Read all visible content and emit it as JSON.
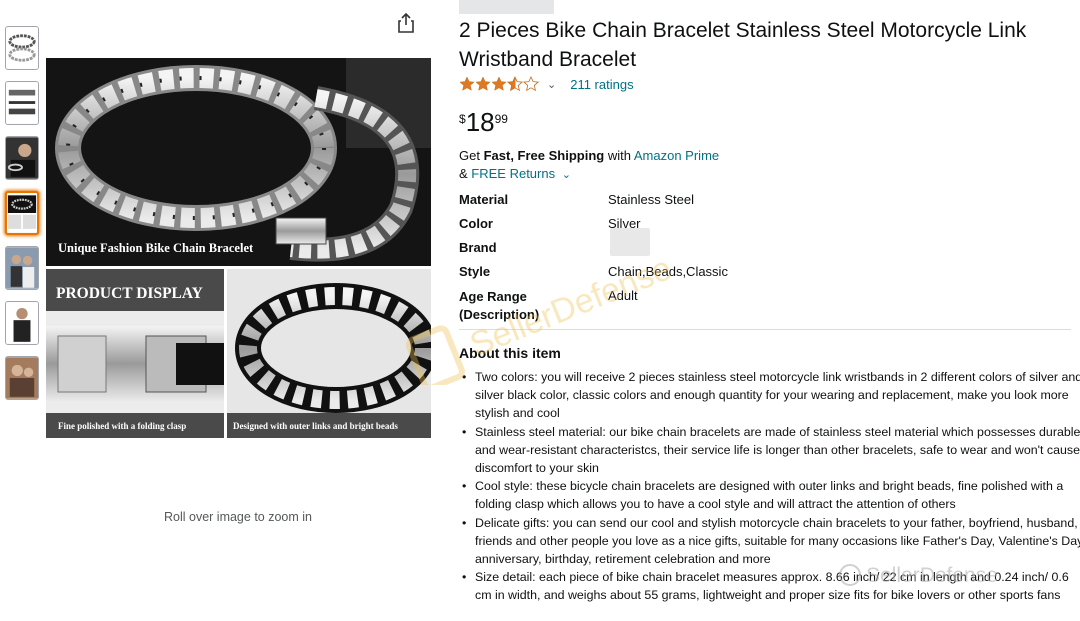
{
  "gallery": {
    "thumbnails": [
      {
        "name": "bracelet-pair"
      },
      {
        "name": "size-chart"
      },
      {
        "name": "model-wearing"
      },
      {
        "name": "product-display",
        "selected": true
      },
      {
        "name": "couple-photo"
      },
      {
        "name": "man-portrait"
      },
      {
        "name": "gift-photo"
      }
    ],
    "share_icon": "share-icon",
    "image_caption_main": "Unique Fashion Bike Chain Bracelet",
    "image_caption_display": "PRODUCT DISPLAY",
    "image_caption_left": "Fine polished with a folding clasp",
    "image_caption_right": "Designed with outer links and bright beads",
    "zoom_hint": "Roll over image to zoom in"
  },
  "product": {
    "title": "2 Pieces Bike Chain Bracelet Stainless Steel Motorcycle Link Wristband Bracelet",
    "rating": 4,
    "ratings_count": "211 ratings",
    "price_symbol": "$",
    "price_whole": "18",
    "price_fraction": "99",
    "shipping_prefix": "Get",
    "shipping_bold": "Fast, Free Shipping",
    "shipping_with": "with",
    "shipping_link": "Amazon Prime",
    "returns_prefix": "&",
    "returns_link": "FREE Returns"
  },
  "specs": [
    {
      "label": "Material",
      "value": "Stainless Steel"
    },
    {
      "label": "Color",
      "value": "Silver"
    },
    {
      "label": "Brand",
      "value": ""
    },
    {
      "label": "Style",
      "value": "Chain,Beads,Classic"
    },
    {
      "label": "Age Range (Description)",
      "value": "Adult"
    }
  ],
  "about": {
    "heading": "About this item",
    "bullets": [
      "Two colors: you will receive 2 pieces stainless steel motorcycle link wristbands in 2 different colors of silver and silver black color, classic colors and enough quantity for your wearing and replacement, make you look more stylish and cool",
      "Stainless steel material: our bike chain bracelets are made of stainless steel material which possesses durable and wear-resistant characteristcs, their service life is longer than other bracelets, safe to wear and won't cause discomfort to your skin",
      "Cool style: these bicycle chain bracelets are designed with outer links and bright beads, fine polished with a folding clasp which allows you to have a cool style and will attract the attention of others",
      "Delicate gifts: you can send our cool and stylish motorcycle chain bracelets to your father, boyfriend, husband, friends and other people you love as a nice gifts, suitable for many occasions like Father's Day, Valentine's Day, anniversary, birthday, retirement celebration and more",
      "Size detail: each piece of bike chain bracelet measures approx. 8.66 inch/ 22 cm in length and 0.24 inch/ 0.6 cm in width, and weighs about 55 grams, lightweight and proper size fits for bike lovers or other sports fans"
    ]
  },
  "watermark": {
    "text": "SellerDefense"
  },
  "colors": {
    "link": "#007185",
    "star": "#de7921",
    "selected_border": "#e77600"
  }
}
